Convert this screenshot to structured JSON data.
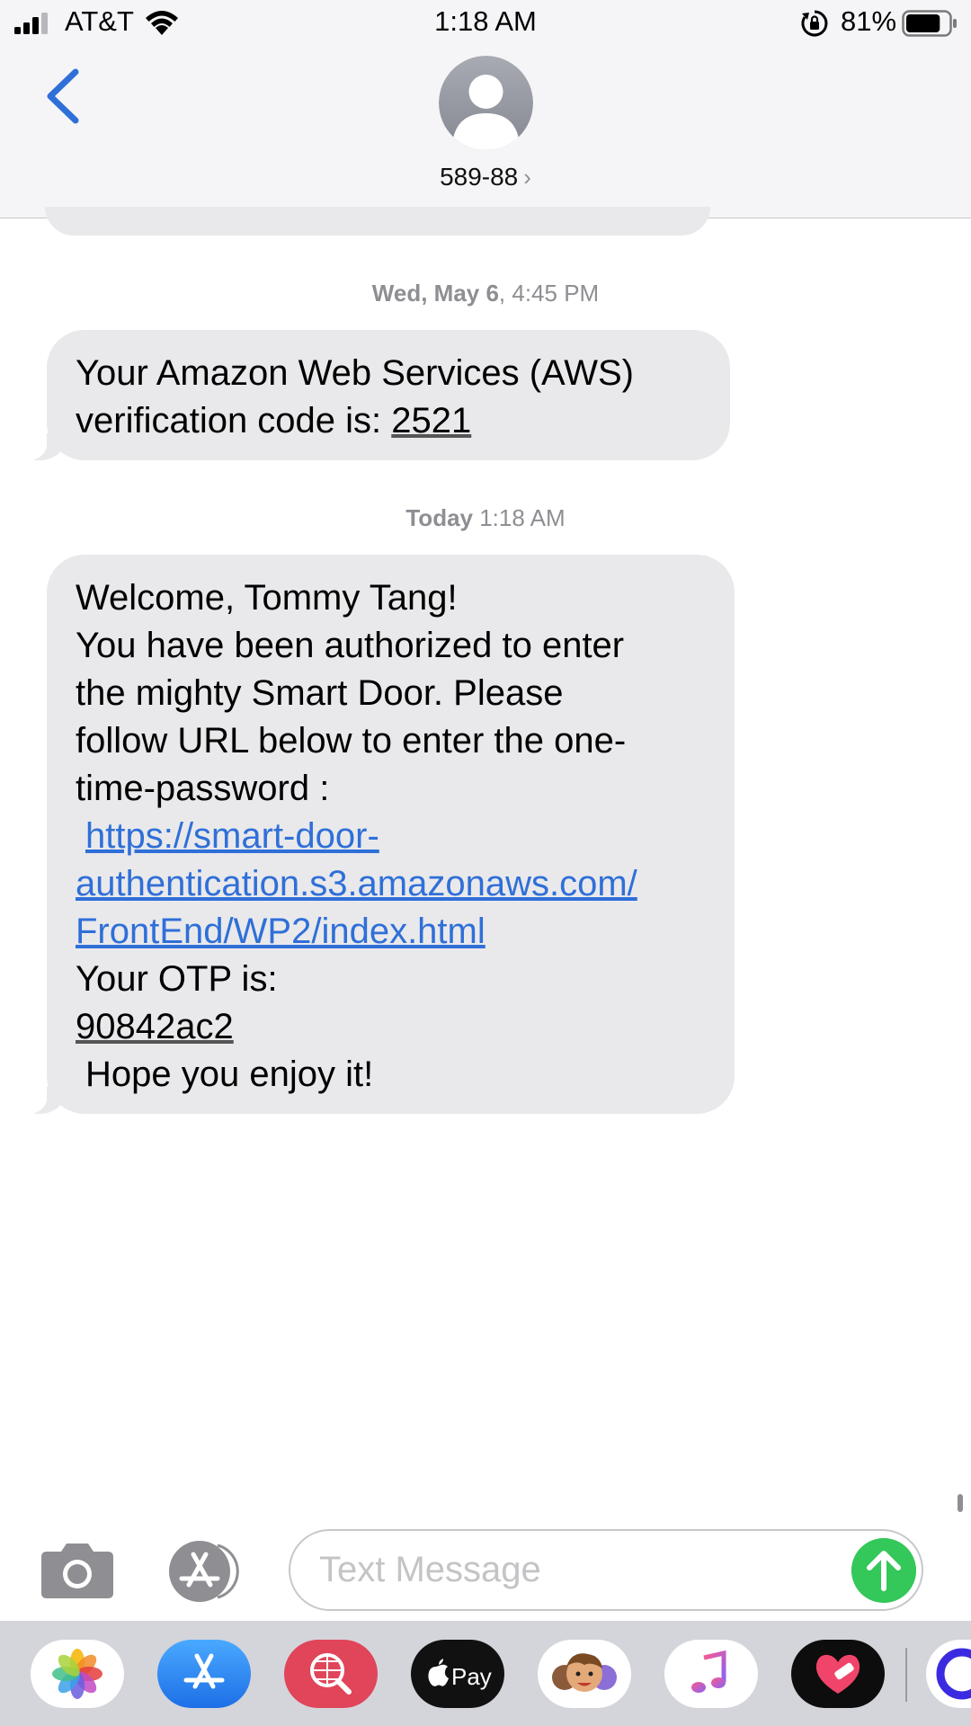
{
  "status_bar": {
    "carrier": "AT&T",
    "time": "1:18 AM",
    "battery_percent": "81%",
    "battery_level": 0.81
  },
  "header": {
    "contact_name": "589-88",
    "contact_chevron": "›",
    "back_icon": "chevron-left-icon",
    "avatar_icon": "person-icon"
  },
  "conversation": {
    "timestamps": [
      {
        "day": "Wed, May 6",
        "time": ", 4:45 PM"
      },
      {
        "day": "Today",
        "time": " 1:18 AM"
      }
    ],
    "messages": [
      {
        "line1": "Your Amazon Web Services (AWS)",
        "line2_prefix": "verification code is: ",
        "code": "2521"
      },
      {
        "line1": "Welcome, Tommy Tang!",
        "line2": "You have been authorized to enter",
        "line3": "the mighty Smart Door. Please",
        "line4": "follow URL below to enter the one-",
        "line5": "time-password :",
        "url_line1": "https://smart-door-",
        "url_line2": "authentication.s3.amazonaws.com/",
        "url_line3": "FrontEnd/WP2/index.html",
        "otp_label": "Your OTP is:",
        "otp_code": "90842ac2",
        "closing": "Hope you enjoy it!"
      }
    ]
  },
  "input_bar": {
    "placeholder": "Text Message",
    "camera_icon": "camera-icon",
    "appstore_icon": "app-store-icon",
    "send_icon": "arrow-up-icon"
  },
  "app_drawer": {
    "apps": [
      "photos-icon",
      "app-store-icon",
      "web-search-icon",
      "apple-pay-icon",
      "memoji-icon",
      "music-icon",
      "heart-sticker-icon",
      "more-apps-icon"
    ],
    "apple_pay_label": "Pay"
  },
  "colors": {
    "accent_blue": "#2f6fd8",
    "bubble_gray": "#e9e9eb",
    "send_green": "#34c759"
  }
}
